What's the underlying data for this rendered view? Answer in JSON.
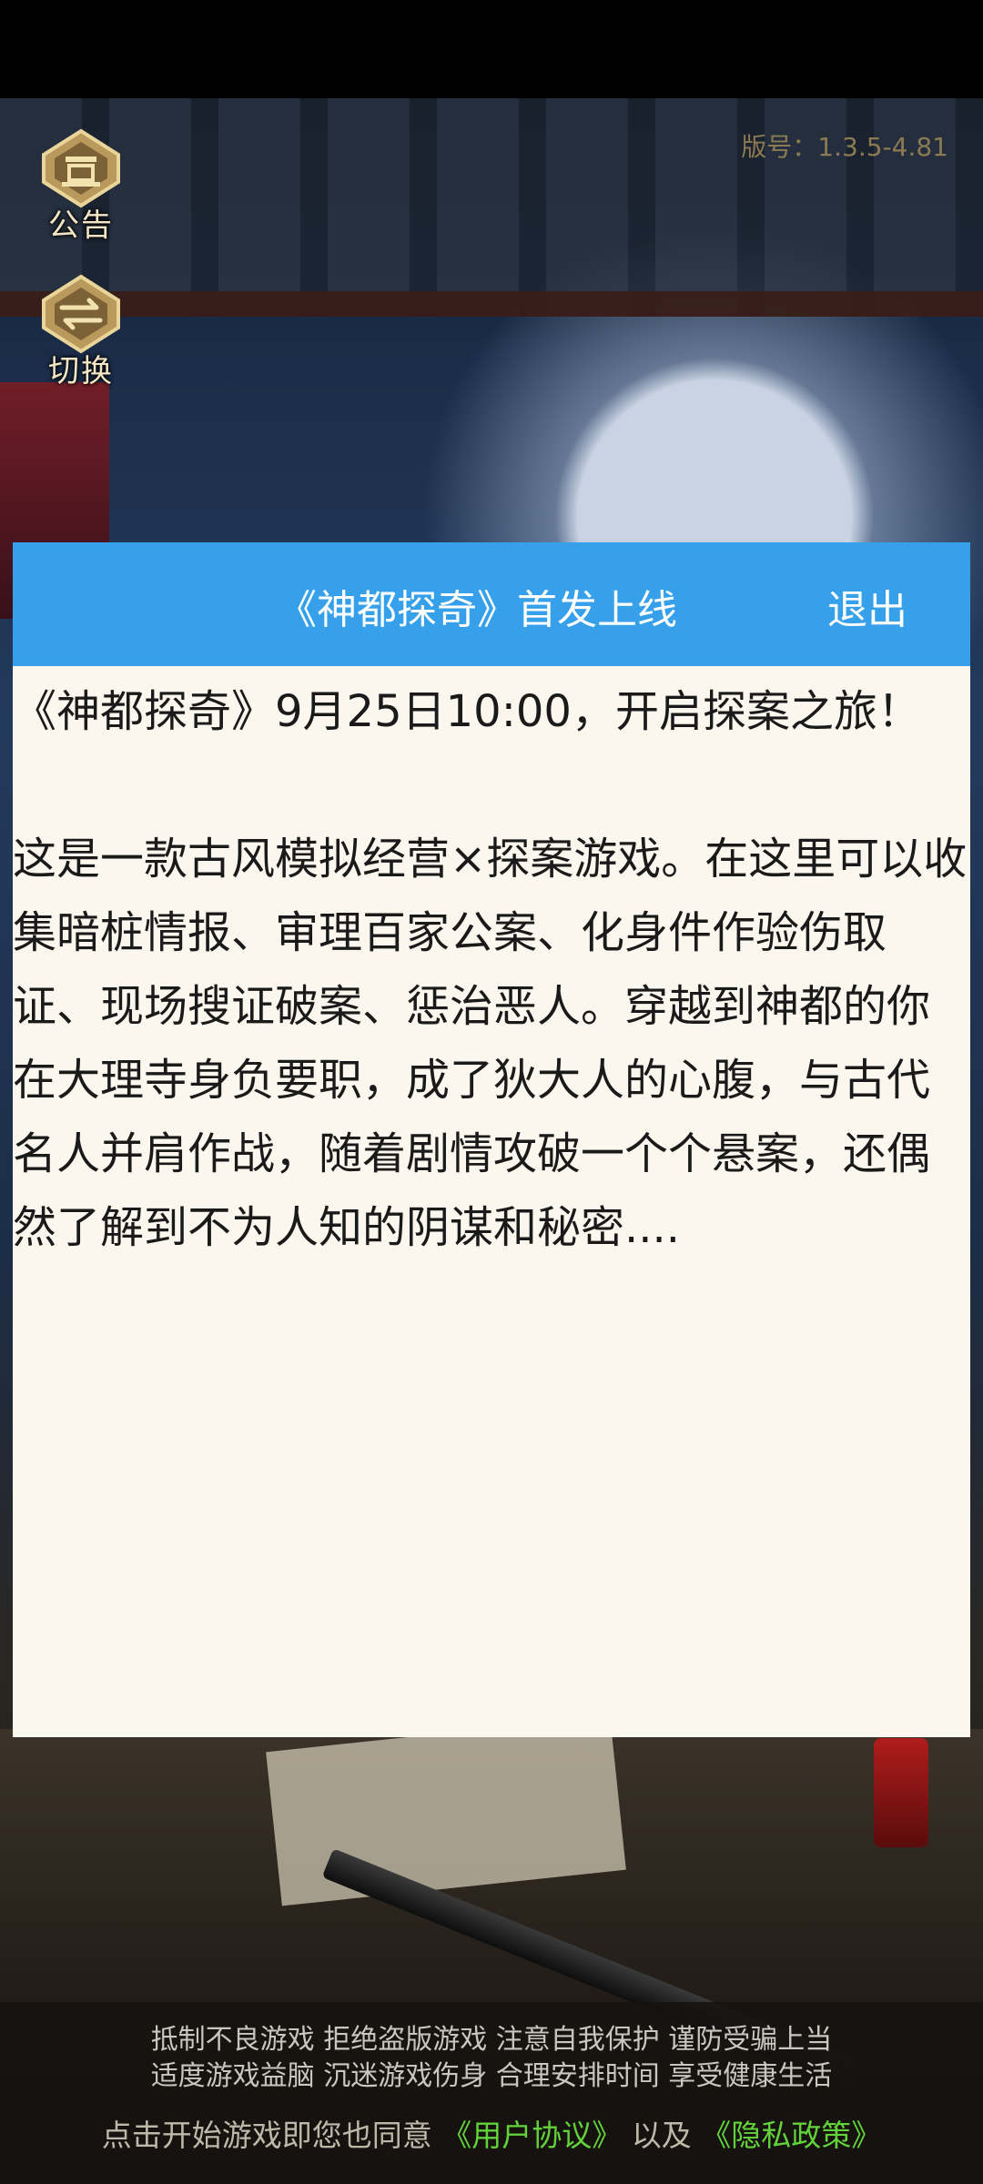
{
  "version_text": "版号：1.3.5-4.81",
  "side_buttons": {
    "notice_label": "公告",
    "switch_label": "切换"
  },
  "dialog": {
    "title": "《神都探奇》首发上线",
    "exit_label": "退出",
    "paragraph1": "《神都探奇》9月25日10:00，开启探案之旅！",
    "paragraph2": "这是一款古风模拟经营×探案游戏。在这里可以收集暗桩情报、审理百家公案、化身件作验伤取证、现场搜证破案、惩治恶人。穿越到神都的你在大理寺身负要职，成了狄大人的心腹，与古代名人并肩作战，随着剧情攻破一个个悬案，还偶然了解到不为人知的阴谋和秘密...."
  },
  "footer": {
    "warning_line1": "抵制不良游戏 拒绝盗版游戏 注意自我保护 谨防受骗上当",
    "warning_line2": "适度游戏益脑 沉迷游戏伤身 合理安排时间 享受健康生活",
    "agreement_prefix": "点击开始游戏即您也同意",
    "user_agreement": "《用户协议》",
    "connector": "以及",
    "privacy_policy": "《隐私政策》"
  },
  "colors": {
    "header_blue": "#36a0ea",
    "link_green": "#63d23a",
    "dialog_bg": "#fbf7ee"
  }
}
